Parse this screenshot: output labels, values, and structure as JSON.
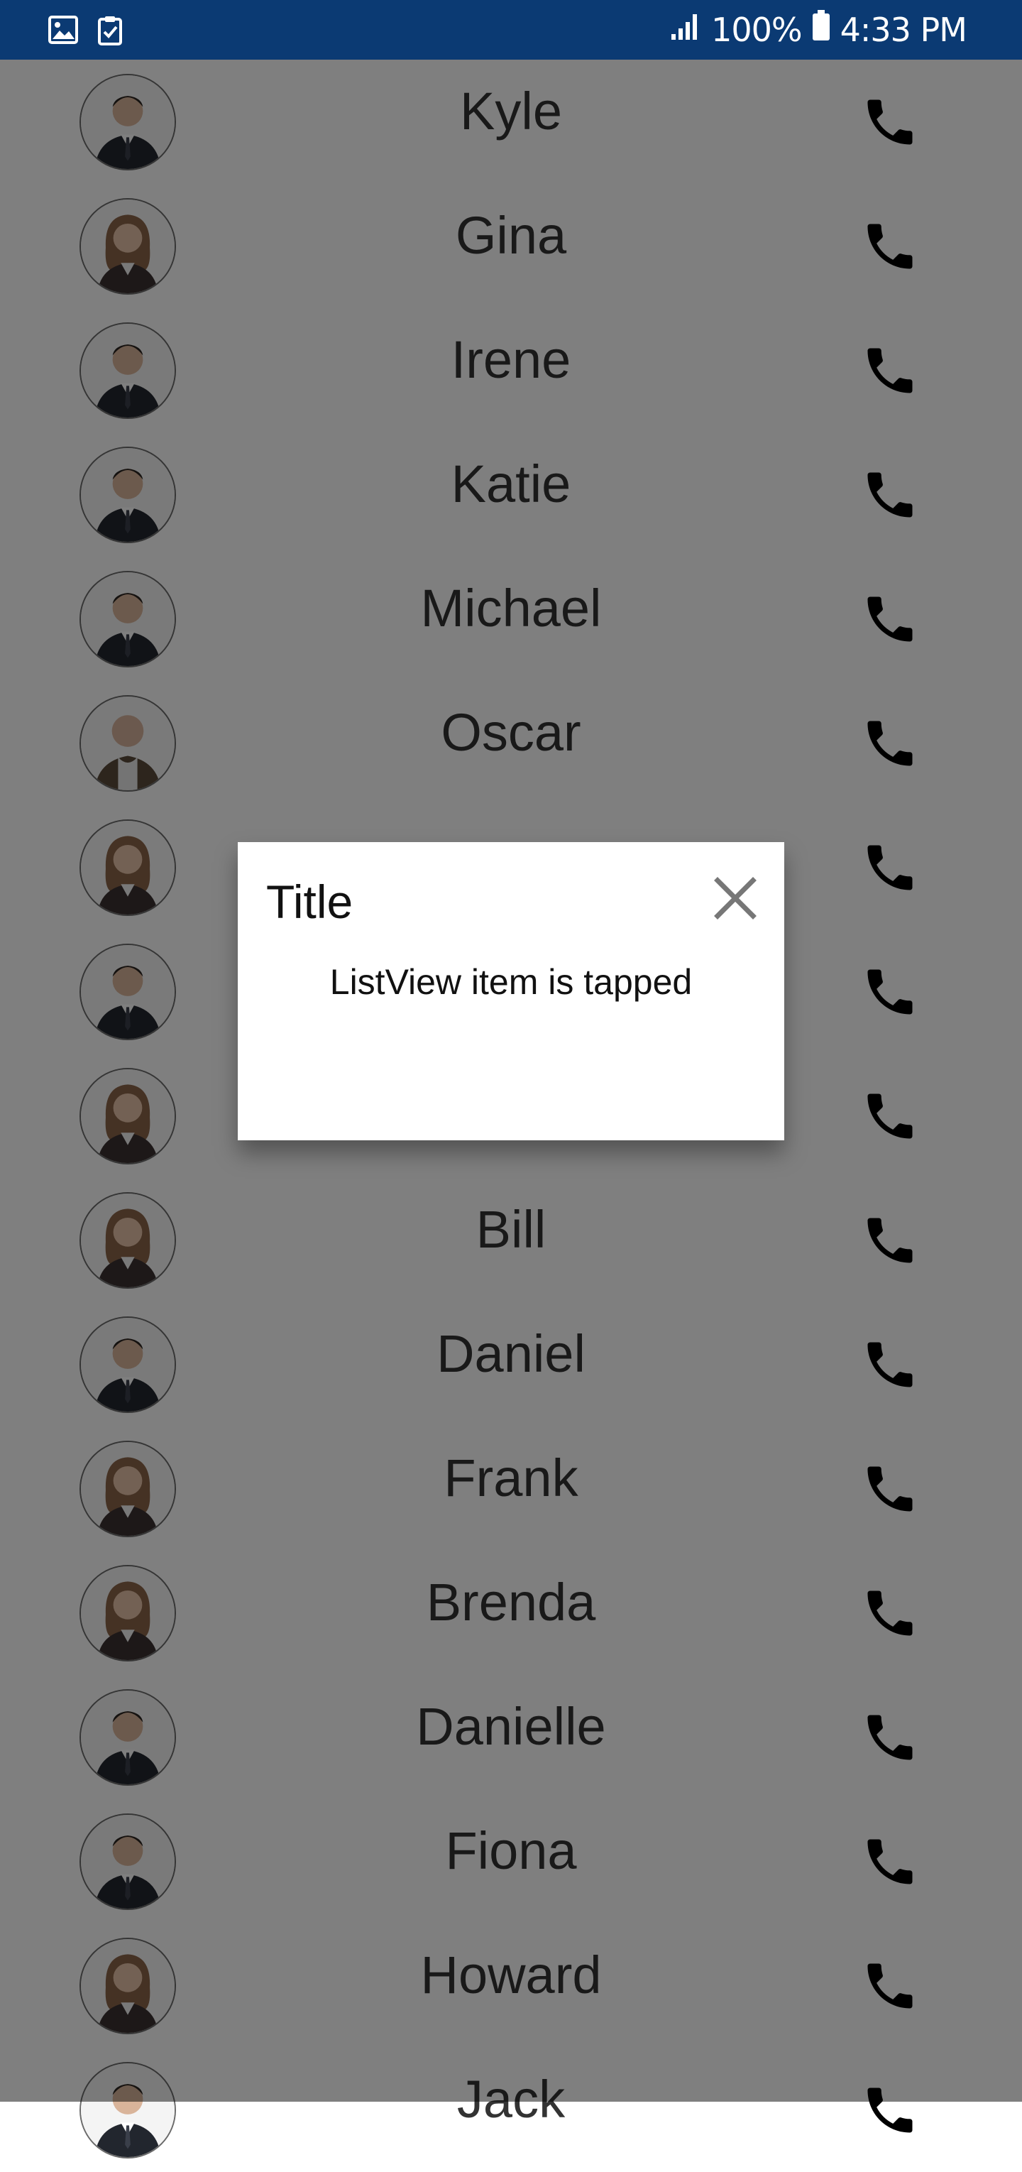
{
  "status_bar": {
    "left_icons": [
      "image-icon",
      "clipboard-check-icon"
    ],
    "signal_icon": "signal-icon",
    "battery_percent": "100%",
    "battery_icon": "battery-icon",
    "time": "4:33 PM"
  },
  "contacts": [
    {
      "name": "Kyle",
      "avatar": "male-suit-avatar"
    },
    {
      "name": "Gina",
      "avatar": "female-avatar"
    },
    {
      "name": "Irene",
      "avatar": "male-suit-avatar"
    },
    {
      "name": "Katie",
      "avatar": "male-suit-avatar"
    },
    {
      "name": "Michael",
      "avatar": "male-suit-avatar"
    },
    {
      "name": "Oscar",
      "avatar": "male-casual-avatar"
    },
    {
      "name": "",
      "avatar": "female-avatar"
    },
    {
      "name": "",
      "avatar": "male-suit-avatar"
    },
    {
      "name": "",
      "avatar": "female-avatar"
    },
    {
      "name": "Bill",
      "avatar": "female-avatar"
    },
    {
      "name": "Daniel",
      "avatar": "male-suit-avatar"
    },
    {
      "name": "Frank",
      "avatar": "female-avatar"
    },
    {
      "name": "Brenda",
      "avatar": "female-avatar"
    },
    {
      "name": "Danielle",
      "avatar": "male-suit-avatar"
    },
    {
      "name": "Fiona",
      "avatar": "male-suit-avatar"
    },
    {
      "name": "Howard",
      "avatar": "female-avatar"
    },
    {
      "name": "Jack",
      "avatar": "male-suit-avatar"
    }
  ],
  "call_icon": "phone-icon",
  "dialog": {
    "title": "Title",
    "message": "ListView item is tapped",
    "close_icon": "close-icon"
  },
  "colors": {
    "status_bar": "#0b3a73",
    "overlay": "rgba(0,0,0,0.5)",
    "dialog_bg": "#ffffff"
  }
}
